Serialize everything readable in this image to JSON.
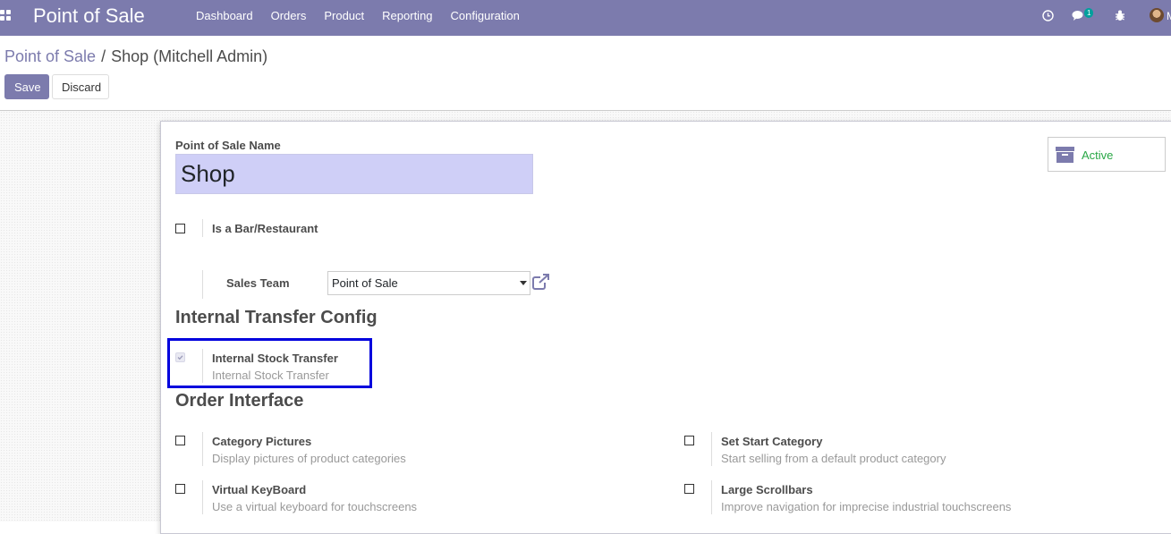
{
  "navbar": {
    "app_name": "Point of Sale",
    "menu": [
      "Dashboard",
      "Orders",
      "Product",
      "Reporting",
      "Configuration"
    ],
    "messages_badge": "1",
    "user_initial": "M",
    "icons": [
      "apps-icon",
      "clock-icon",
      "chat-icon",
      "bug-icon"
    ]
  },
  "breadcrumb": {
    "parent": "Point of Sale",
    "separator": "/",
    "current": "Shop (Mitchell Admin)"
  },
  "buttons": {
    "save": "Save",
    "discard": "Discard"
  },
  "form": {
    "name_label": "Point of Sale Name",
    "name_value": "Shop",
    "active_label": "Active",
    "bar_restaurant": {
      "label": "Is a Bar/Restaurant",
      "checked": false
    },
    "sales_team": {
      "label": "Sales Team",
      "value": "Point of Sale"
    },
    "internal_transfer_section": "Internal Transfer Config",
    "internal_stock_transfer": {
      "title": "Internal Stock Transfer",
      "desc": "Internal Stock Transfer",
      "checked": true
    },
    "order_interface_section": "Order Interface",
    "settings": [
      {
        "title": "Category Pictures",
        "desc": "Display pictures of product categories"
      },
      {
        "title": "Set Start Category",
        "desc": "Start selling from a default product category"
      },
      {
        "title": "Virtual KeyBoard",
        "desc": "Use a virtual keyboard for touchscreens"
      },
      {
        "title": "Large Scrollbars",
        "desc": "Improve navigation for imprecise industrial touchscreens"
      }
    ]
  },
  "colors": {
    "brand": "#7c7bad",
    "name_input_bg": "#cfcff7",
    "active_green": "#28a745",
    "highlight_blue": "#0000dd",
    "badge_teal": "#00a09d"
  }
}
